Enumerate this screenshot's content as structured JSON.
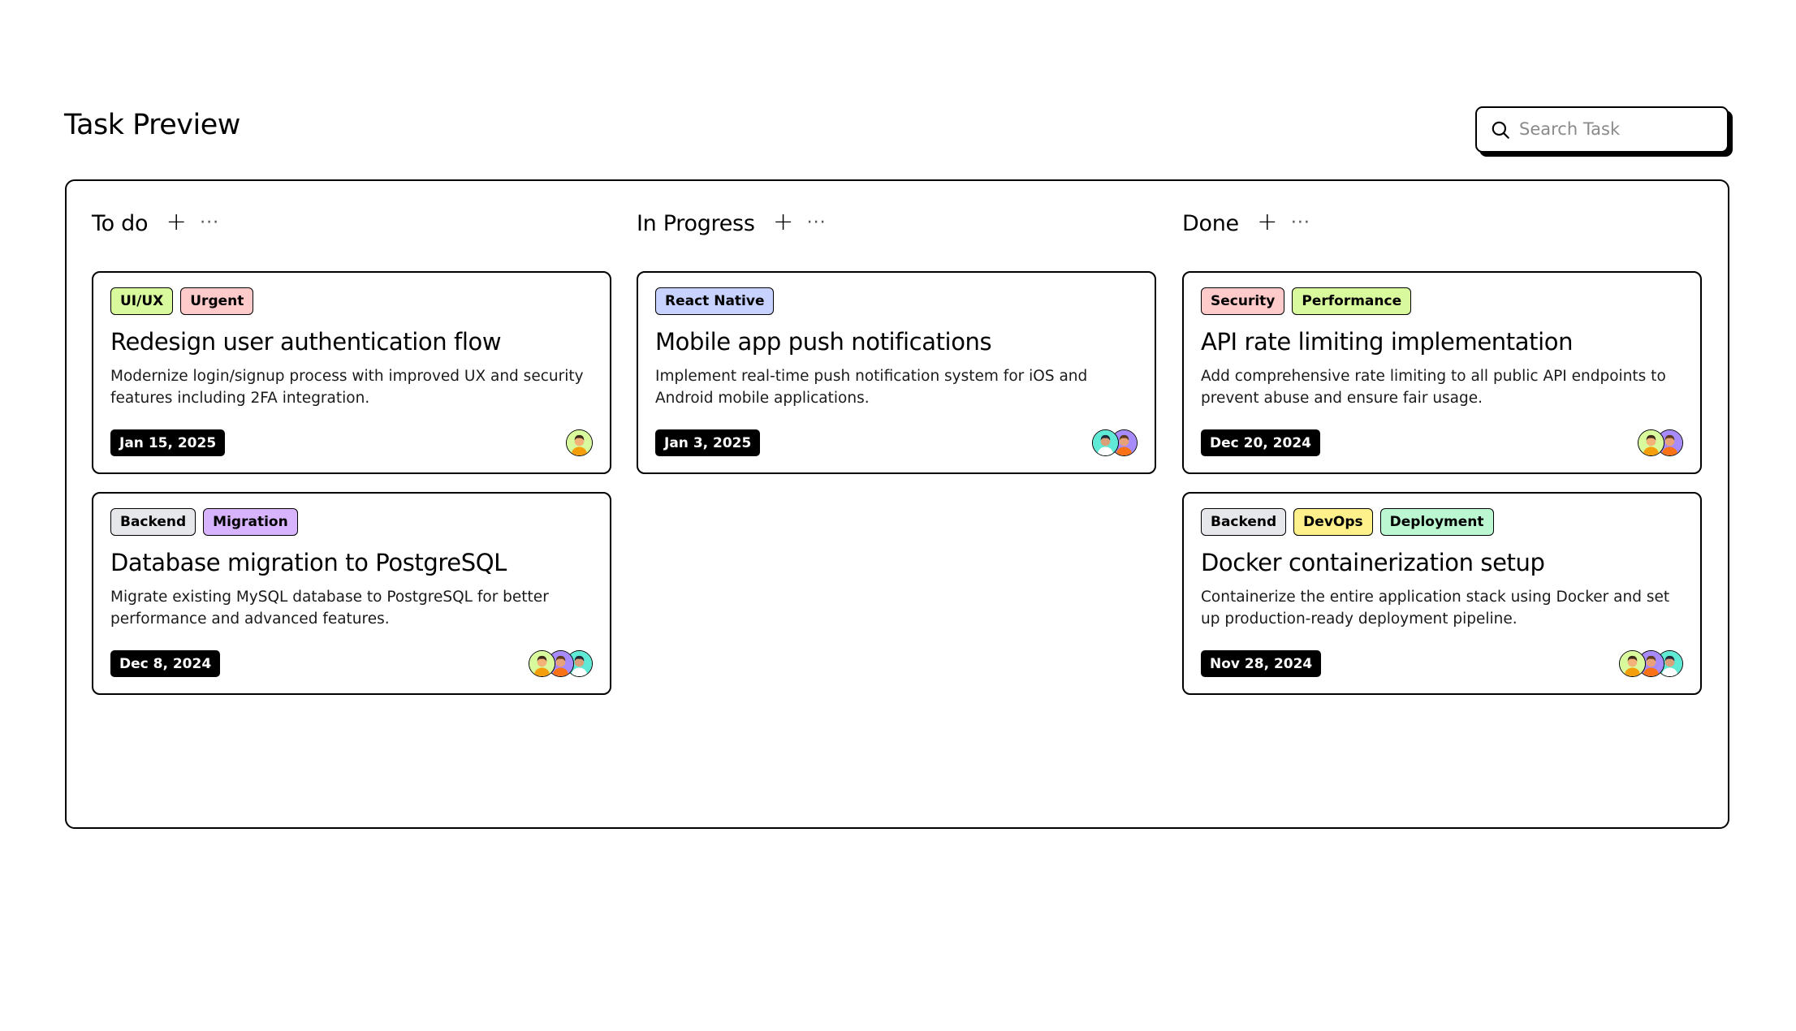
{
  "page": {
    "title": "Task Preview"
  },
  "search": {
    "placeholder": "Search Task",
    "icon": "search-icon"
  },
  "columns": [
    {
      "title": "To do",
      "add_icon": "plus-icon",
      "more_icon": "more-horizontal-icon",
      "more_label": "···",
      "add_label": "+",
      "cards": [
        {
          "tags": [
            {
              "label": "UI/UX",
              "color": "#d9f99d"
            },
            {
              "label": "Urgent",
              "color": "#fecaca"
            }
          ],
          "title": "Redesign user authentication flow",
          "description": "Modernize login/signup process with improved UX and security features including 2FA integration.",
          "date": "Jan 15, 2025",
          "assignees": [
            "lime"
          ]
        },
        {
          "tags": [
            {
              "label": "Backend",
              "color": "#e5e7eb"
            },
            {
              "label": "Migration",
              "color": "#d8b4fe"
            }
          ],
          "title": "Database migration to PostgreSQL",
          "description": "Migrate existing MySQL database to PostgreSQL for better performance and advanced features.",
          "date": "Dec 8, 2024",
          "assignees": [
            "lime",
            "purple",
            "teal"
          ]
        }
      ]
    },
    {
      "title": "In Progress",
      "add_icon": "plus-icon",
      "more_icon": "more-horizontal-icon",
      "more_label": "···",
      "add_label": "+",
      "cards": [
        {
          "tags": [
            {
              "label": "React Native",
              "color": "#c7d2fe"
            }
          ],
          "title": "Mobile app push notifications",
          "description": "Implement real-time push notification system for iOS and Android mobile applications.",
          "date": "Jan 3, 2025",
          "assignees": [
            "teal",
            "purple"
          ]
        }
      ]
    },
    {
      "title": "Done",
      "add_icon": "plus-icon",
      "more_icon": "more-horizontal-icon",
      "more_label": "···",
      "add_label": "+",
      "cards": [
        {
          "tags": [
            {
              "label": "Security",
              "color": "#fecaca"
            },
            {
              "label": "Performance",
              "color": "#d9f99d"
            }
          ],
          "title": "API rate limiting implementation",
          "description": "Add comprehensive rate limiting to all public API endpoints to prevent abuse and ensure fair usage.",
          "date": "Dec 20, 2024",
          "assignees": [
            "lime",
            "purple"
          ]
        },
        {
          "tags": [
            {
              "label": "Backend",
              "color": "#e5e7eb"
            },
            {
              "label": "DevOps",
              "color": "#fef08a"
            },
            {
              "label": "Deployment",
              "color": "#bbf7d0"
            }
          ],
          "title": "Docker containerization setup",
          "description": "Containerize the entire application stack using Docker and set up production-ready deployment pipeline.",
          "date": "Nov 28, 2024",
          "assignees": [
            "lime",
            "purple",
            "teal"
          ]
        }
      ]
    }
  ],
  "avatar_colors": {
    "lime": {
      "bg": "#d9f99d",
      "skin": "#f2b27a",
      "hair": "#3b2a1a",
      "shirt": "#f59e0b"
    },
    "purple": {
      "bg": "#a78bfa",
      "skin": "#e8a27a",
      "hair": "#5b3a1e",
      "shirt": "#f97316"
    },
    "teal": {
      "bg": "#5eead4",
      "skin": "#d9a07a",
      "hair": "#1f2937",
      "shirt": "#ffffff"
    }
  }
}
